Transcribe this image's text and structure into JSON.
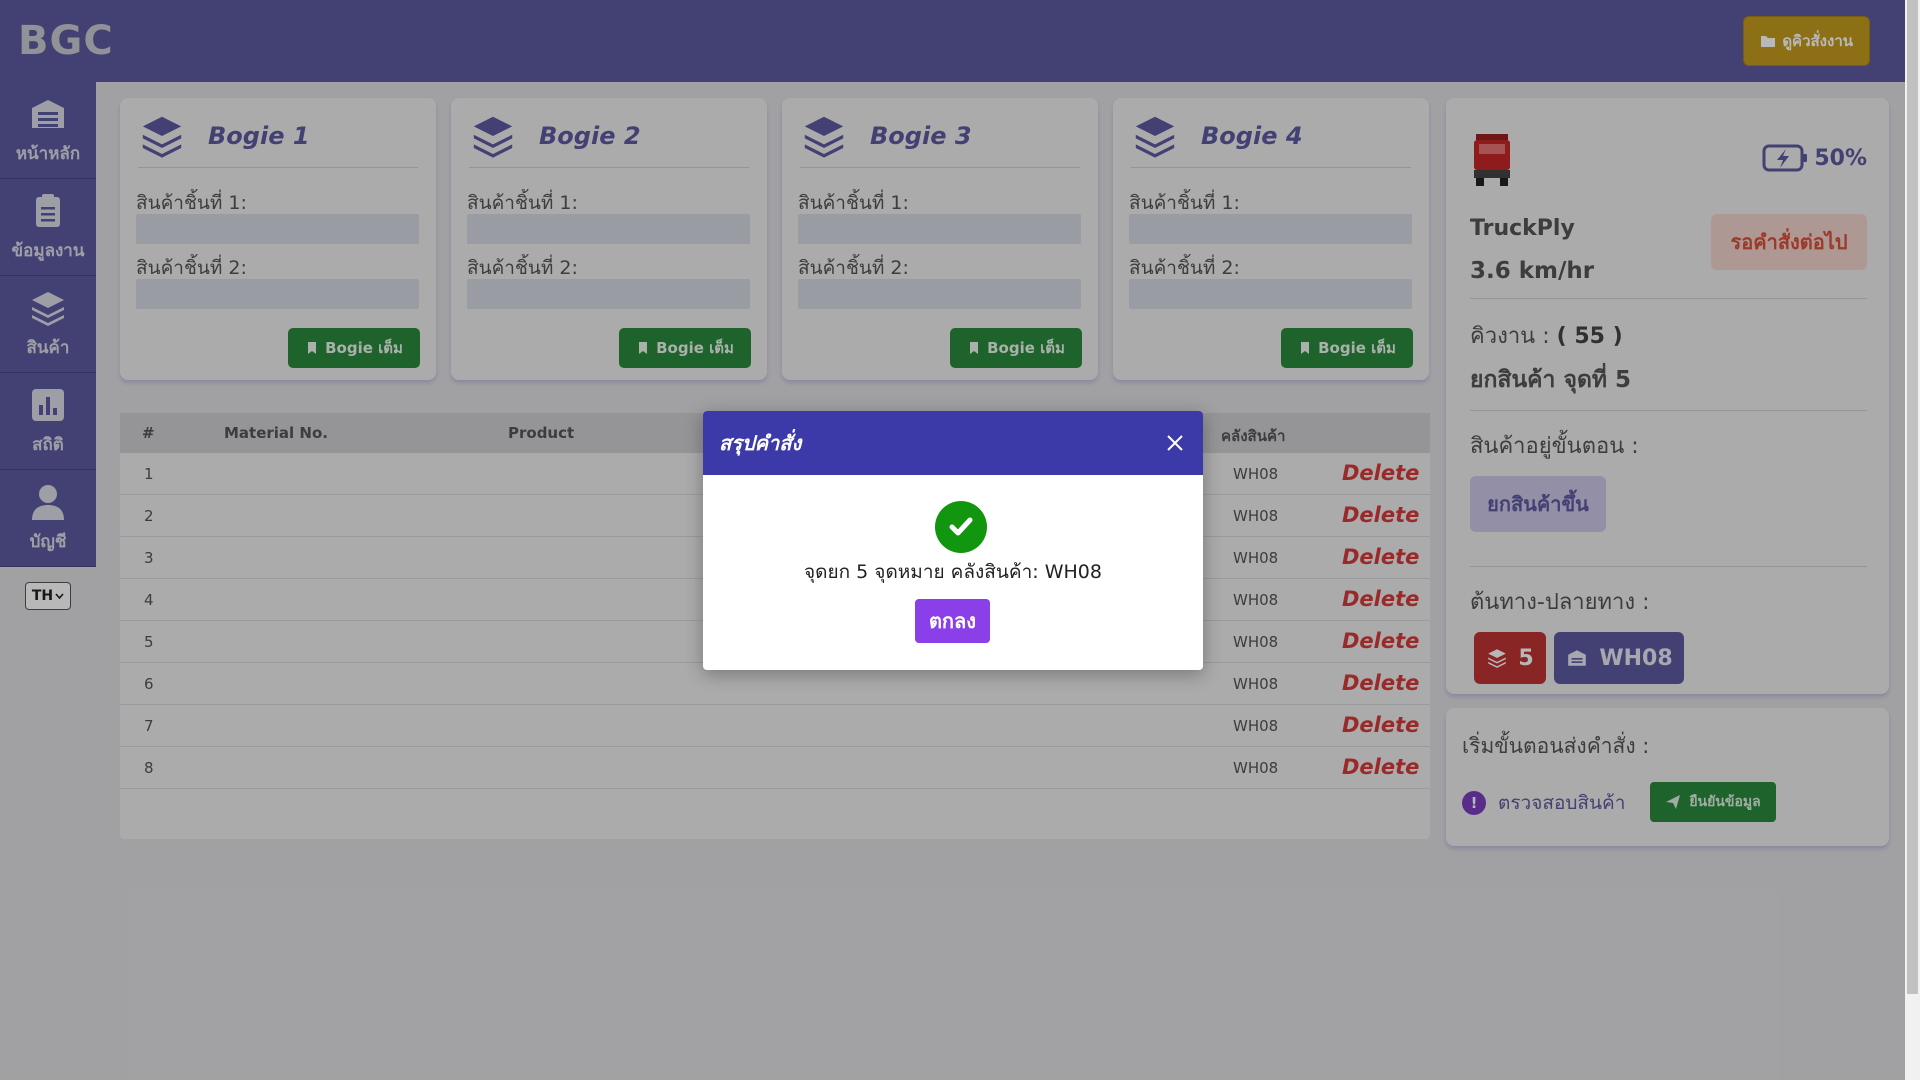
{
  "header": {
    "logo": "BGC",
    "queue_button": "ดูคิวสั่งงาน"
  },
  "sidebar": {
    "items": [
      {
        "label": "หน้าหลัก",
        "icon": "warehouse-icon"
      },
      {
        "label": "ข้อมูลงาน",
        "icon": "clipboard-icon"
      },
      {
        "label": "สินค้า",
        "icon": "layers-icon"
      },
      {
        "label": "สถิติ",
        "icon": "chart-icon"
      },
      {
        "label": "บัญชี",
        "icon": "user-icon"
      }
    ],
    "language": "TH"
  },
  "bogies": [
    {
      "title": "Bogie 1",
      "slot1_label": "สินค้าชิ้นที่ 1:",
      "slot2_label": "สินค้าชิ้นที่ 2:",
      "button": "Bogie เต็ม"
    },
    {
      "title": "Bogie 2",
      "slot1_label": "สินค้าชิ้นที่ 1:",
      "slot2_label": "สินค้าชิ้นที่ 2:",
      "button": "Bogie เต็ม"
    },
    {
      "title": "Bogie 3",
      "slot1_label": "สินค้าชิ้นที่ 1:",
      "slot2_label": "สินค้าชิ้นที่ 2:",
      "button": "Bogie เต็ม"
    },
    {
      "title": "Bogie 4",
      "slot1_label": "สินค้าชิ้นที่ 1:",
      "slot2_label": "สินค้าชิ้นที่ 2:",
      "button": "Bogie เต็ม"
    }
  ],
  "table": {
    "headers": {
      "num": "#",
      "material": "Material No.",
      "product": "Product",
      "warehouse": "คลังสินค้า"
    },
    "rows": [
      {
        "num": "1",
        "warehouse": "WH08",
        "action": "Delete"
      },
      {
        "num": "2",
        "warehouse": "WH08",
        "action": "Delete"
      },
      {
        "num": "3",
        "warehouse": "WH08",
        "action": "Delete"
      },
      {
        "num": "4",
        "warehouse": "WH08",
        "action": "Delete"
      },
      {
        "num": "5",
        "warehouse": "WH08",
        "action": "Delete"
      },
      {
        "num": "6",
        "warehouse": "WH08",
        "action": "Delete"
      },
      {
        "num": "7",
        "warehouse": "WH08",
        "action": "Delete"
      },
      {
        "num": "8",
        "warehouse": "WH08",
        "action": "Delete"
      }
    ]
  },
  "truck": {
    "name": "TruckPly",
    "speed": "3.6 km/hr",
    "battery": "50%",
    "status_badge": "รอคำสั่งต่อไป",
    "queue_label": "คิวงาน : ",
    "queue_value": "( 55 )",
    "task": "ยกสินค้า จุดที่ 5",
    "step_label": "สินค้าอยู่ขั้นตอน :",
    "step_badge": "ยกสินค้าขึ้น",
    "route_label": "ต้นทาง-ปลายทาง :",
    "route_origin": "5",
    "route_destination": "WH08"
  },
  "dispatch": {
    "title": "เริ่มขั้นตอนส่งคำสั่ง :",
    "check_link": "ตรวจสอบสินค้า",
    "confirm_button": "ยืนยันข้อมูล"
  },
  "modal": {
    "title": "สรุปคำสั่ง",
    "message": "จุดยก 5 จุดหมาย คลังสินค้า: WH08",
    "ok_button": "ตกลง"
  },
  "colors": {
    "primary": "#5d5aa0",
    "success": "#2b8a3e",
    "danger": "#d63a3a",
    "accent": "#8b3fe8",
    "gold": "#c49a1e"
  }
}
